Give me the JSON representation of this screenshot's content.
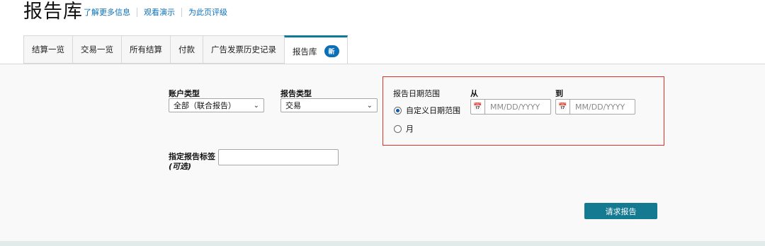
{
  "header": {
    "title": "报告库",
    "links": [
      "了解更多信息",
      "观看演示",
      "为此页评级"
    ]
  },
  "tabs": [
    {
      "label": "结算一览"
    },
    {
      "label": "交易一览"
    },
    {
      "label": "所有结算"
    },
    {
      "label": "付款"
    },
    {
      "label": "广告发票历史记录"
    },
    {
      "label": "报告库",
      "badge": "新",
      "active": true
    }
  ],
  "form": {
    "account_type": {
      "label": "账户类型",
      "value": "全部（联合报告）"
    },
    "report_type": {
      "label": "报告类型",
      "value": "交易"
    },
    "date_range": {
      "label": "报告日期范围",
      "from_label": "从",
      "to_label": "到",
      "options": [
        {
          "label": "自定义日期范围",
          "selected": true
        },
        {
          "label": "月",
          "selected": false
        }
      ],
      "from_placeholder": "MM/DD/YYYY",
      "to_placeholder": "MM/DD/YYYY"
    },
    "tag": {
      "label": "指定报告标签",
      "optional": "(可选)",
      "value": ""
    },
    "submit_label": "请求报告"
  },
  "colors": {
    "accent": "#137a92",
    "link": "#0b6fb8",
    "highlight_border": "#e0322b",
    "badge": "#0b6fb8"
  }
}
